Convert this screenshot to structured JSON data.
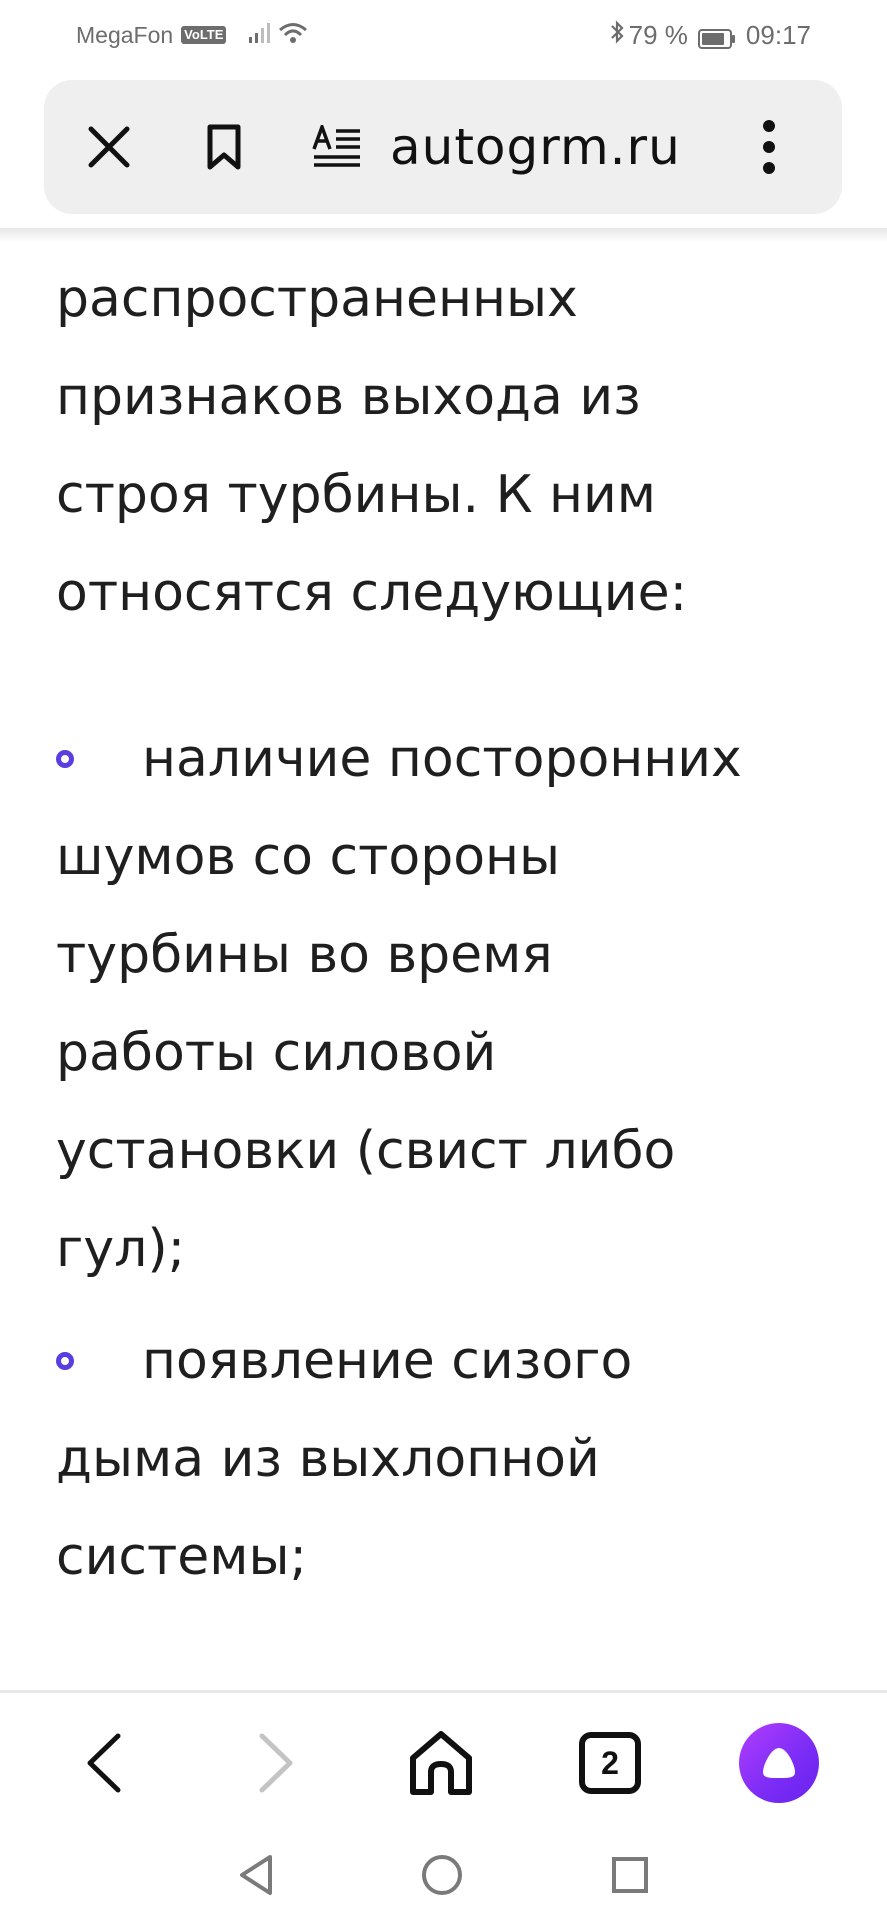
{
  "status_bar": {
    "carrier": "MegaFon",
    "volte": "VoLTE",
    "battery_percent": "79 %",
    "time": "09:17",
    "icons": [
      "signal-icon",
      "wifi-icon",
      "bluetooth-icon",
      "battery-icon"
    ]
  },
  "address_bar": {
    "url": "autogrm.ru",
    "icons": [
      "close-icon",
      "bookmark-icon",
      "reader-mode-icon",
      "more-menu-icon"
    ]
  },
  "article": {
    "intro_lines": [
      "распространенных",
      "признаков выхода из",
      "строя турбины. К ним",
      "относятся следующие:"
    ],
    "bullets": [
      {
        "lines": [
          "наличие посторонних",
          "шумов со стороны",
          "турбины во время",
          "работы силовой",
          "установки (свист либо",
          "гул);"
        ]
      },
      {
        "lines": [
          "появление сизого",
          "дыма из выхлопной",
          "системы;"
        ]
      }
    ],
    "bullet_color": "#5a3ee0"
  },
  "toolbar": {
    "tabs_count": "2",
    "icons": [
      "back-arrow-icon",
      "forward-arrow-icon",
      "home-icon",
      "tabs-icon",
      "alice-assistant-icon"
    ],
    "accent": "#8a2cf3"
  },
  "system_nav": {
    "icons": [
      "nav-back-triangle-icon",
      "nav-home-circle-icon",
      "nav-recents-square-icon"
    ]
  }
}
